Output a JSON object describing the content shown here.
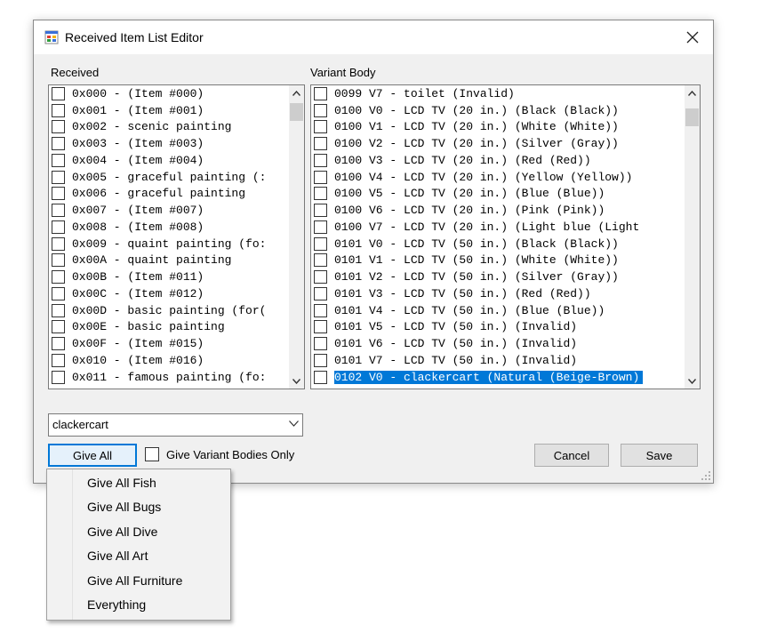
{
  "window": {
    "title": "Received Item List Editor",
    "icon": "app-icon",
    "close_icon": "close-icon"
  },
  "received": {
    "label": "Received",
    "items": [
      "0x000 - (Item #000)",
      "0x001 - (Item #001)",
      "0x002 - scenic painting",
      "0x003 - (Item #003)",
      "0x004 - (Item #004)",
      "0x005 - graceful painting (:",
      "0x006 - graceful painting",
      "0x007 - (Item #007)",
      "0x008 - (Item #008)",
      "0x009 - quaint painting (fo:",
      "0x00A - quaint painting",
      "0x00B - (Item #011)",
      "0x00C - (Item #012)",
      "0x00D - basic painting (for(",
      "0x00E - basic painting",
      "0x00F - (Item #015)",
      "0x010 - (Item #016)",
      "0x011 - famous painting (fo:"
    ]
  },
  "variant": {
    "label": "Variant Body",
    "items": [
      "0099 V7 - toilet (Invalid)",
      "0100 V0 - LCD TV (20 in.) (Black (Black))",
      "0100 V1 - LCD TV (20 in.) (White (White))",
      "0100 V2 - LCD TV (20 in.) (Silver (Gray))",
      "0100 V3 - LCD TV (20 in.) (Red (Red))",
      "0100 V4 - LCD TV (20 in.) (Yellow (Yellow))",
      "0100 V5 - LCD TV (20 in.) (Blue (Blue))",
      "0100 V6 - LCD TV (20 in.) (Pink (Pink))",
      "0100 V7 - LCD TV (20 in.) (Light blue (Light",
      "0101 V0 - LCD TV (50 in.) (Black (Black))",
      "0101 V1 - LCD TV (50 in.) (White (White))",
      "0101 V2 - LCD TV (50 in.) (Silver (Gray))",
      "0101 V3 - LCD TV (50 in.) (Red (Red))",
      "0101 V4 - LCD TV (50 in.) (Blue (Blue))",
      "0101 V5 - LCD TV (50 in.) (Invalid)",
      "0101 V6 - LCD TV (50 in.) (Invalid)",
      "0101 V7 - LCD TV (50 in.) (Invalid)",
      "0102 V0 - clackercart (Natural (Beige-Brown)"
    ],
    "selected_index": 17
  },
  "search": {
    "value": "clackercart"
  },
  "buttons": {
    "give_all": "Give All",
    "cancel": "Cancel",
    "save": "Save"
  },
  "checkbox": {
    "label": "Give Variant Bodies Only",
    "checked": false
  },
  "menu": {
    "items": [
      "Give All Fish",
      "Give All Bugs",
      "Give All Dive",
      "Give All Art",
      "Give All Furniture",
      "Everything"
    ]
  },
  "colors": {
    "selection": "#0078d7",
    "focus_border": "#0078d7"
  }
}
